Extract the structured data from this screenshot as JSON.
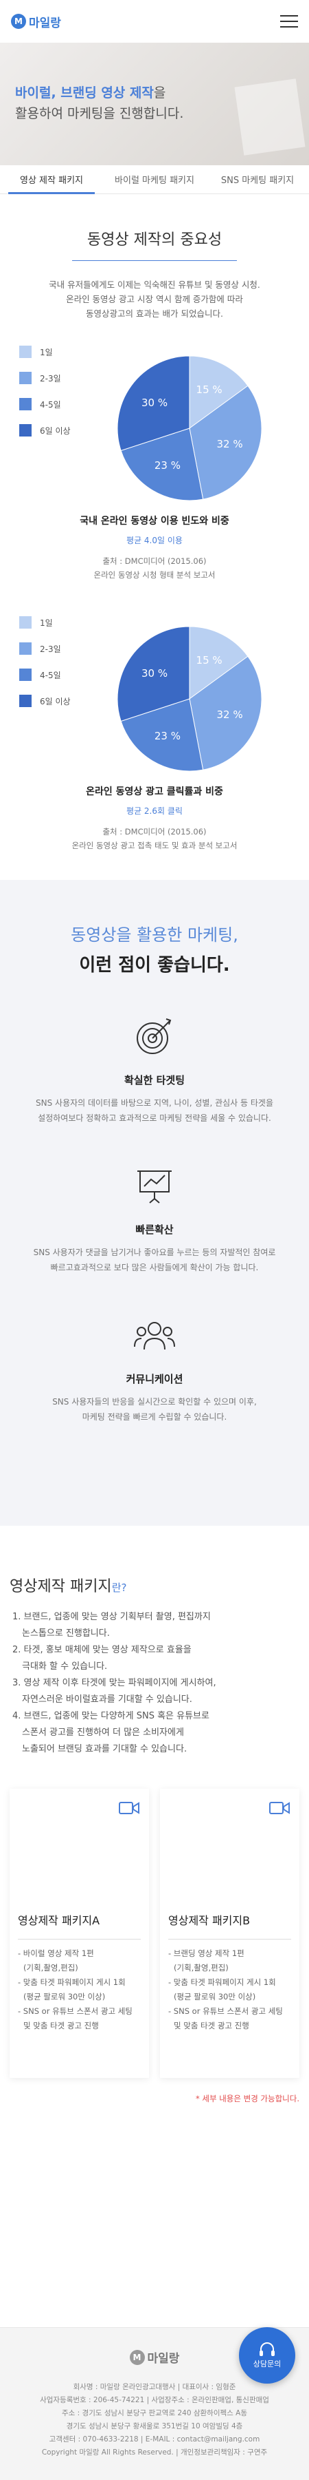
{
  "header": {
    "logo_text": "마일랑",
    "logo_mark": "M"
  },
  "hero": {
    "line1_highlight": "바이럴, 브랜딩 영상 제작",
    "line1_rest": "을",
    "line2": "활용하여 마케팅을 진행합니다."
  },
  "tabs": [
    {
      "label": "영상 제작 패키지"
    },
    {
      "label": "바이럴 마케팅 패키지"
    },
    {
      "label": "SNS 마케팅 패키지"
    }
  ],
  "importance": {
    "title": "동영상 제작의 중요성",
    "intro": [
      "국내 유저들에게도 이제는 익숙해진 유튜브 및 동영상 시청.",
      "온라인 동영상 광고 시장 역시 함께 증가함에 따라",
      "동영상광고의 효과는 배가 되었습니다."
    ]
  },
  "chart_data": [
    {
      "type": "pie",
      "title": "국내 온라인 동영상 이용 빈도와 비중",
      "subtitle": "평균 4.0일 이용",
      "source_lines": [
        "출처 : DMC미디어 (2015.06)",
        "온라인 동영상 시청 형태 분석 보고서"
      ],
      "categories": [
        "1일",
        "2-3일",
        "4-5일",
        "6일 이상"
      ],
      "values": [
        15,
        32,
        23,
        30
      ],
      "colors": [
        "#b9d0f2",
        "#7ea7e6",
        "#5585d6",
        "#3a69c4"
      ]
    },
    {
      "type": "pie",
      "title": "온라인 동영상 광고 클릭률과 비중",
      "subtitle": "평균 2.6회 클릭",
      "source_lines": [
        "출처 : DMC미디어 (2015.06)",
        "온라인 동영상 광고 접촉 태도 및 효과 분석 보고서"
      ],
      "categories": [
        "1일",
        "2-3일",
        "4-5일",
        "6일 이상"
      ],
      "values": [
        15,
        32,
        23,
        30
      ],
      "colors": [
        "#b9d0f2",
        "#7ea7e6",
        "#5585d6",
        "#3a69c4"
      ]
    }
  ],
  "benefits": {
    "title": "동영상을 활용한 마케팅,",
    "title2": "이런 점이 좋습니다.",
    "items": [
      {
        "name": "확실한 타겟팅",
        "desc": [
          "SNS 사용자의 데이터를 바탕으로 지역, 나이, 성별, 관심사 등 타겟을",
          "설정하여보다 정확하고 효과적으로 마케팅 전략을 세울 수 있습니다."
        ]
      },
      {
        "name": "빠른확산",
        "desc": [
          "SNS 사용자가 댓글을 남기거나 좋아요를 누르는 등의 자발적인 참여로",
          "빠르고효과적으로 보다 많은 사람들에게 확산이 가능 합니다."
        ]
      },
      {
        "name": "커뮤니케이션",
        "desc": [
          "SNS 사용자들의 반응을 실시간으로 확인할 수 있으며 이후,",
          "마케팅 전략을 빠르게 수립할 수 있습니다."
        ]
      }
    ]
  },
  "packages": {
    "title": "영상제작 패키지",
    "title_suffix": "란?",
    "list": [
      "1. 브랜드, 업종에 맞는 영상 기획부터 촬영, 편집까지",
      "   논스톱으로 진행합니다.",
      "2. 타겟, 홍보 매체에 맞는 영상 제작으로 효율을",
      "   극대화 할 수 있습니다.",
      "3. 영상 제작 이후 타겟에 맞는 파워페이지에 게시하여,",
      "   자연스러운 바이럴효과를 기대할 수 있습니다.",
      "4. 브랜드, 업종에 맞는 다양하게 SNS 혹은 유튜브로",
      "   스폰서 광고를 진행하여 더 많은 소비자에게",
      "   노출되어 브랜딩 효과를 기대할 수 있습니다."
    ],
    "cards": [
      {
        "name": "영상제작 패키지A",
        "items": [
          "- 바이럴 영상 제작 1편",
          "  (기획,촬영,편집)",
          "- 맞춤 타겟 파워페이지 게시 1회",
          "  (평균 팔로워 30만 이상)",
          "- SNS or 유튜브 스폰서 광고 세팅",
          "  및 맞춤 타겟 광고 진행"
        ]
      },
      {
        "name": "영상제작 패키지B",
        "items": [
          "- 브랜딩 영상 제작 1편",
          "  (기획,촬영,편집)",
          "- 맞춤 타겟 파워페이지 게시 1회",
          "  (평균 팔로워 30만 이상)",
          "- SNS or 유튜브 스폰서 광고 세팅",
          "  및 맞춤 타겟 광고 진행"
        ]
      }
    ],
    "note": "* 세부 내용은 변경 가능합니다."
  },
  "footer": {
    "lines": [
      "회사명 : 마일랑 온라인광고대행사 | 대표이사 : 임형준",
      "사업자등록번호 : 206-45-74221 | 사업장주소 : 온라인판매업, 통신판매업",
      "주소 : 경기도 성남시 분당구 판교역로 240 삼환하이펙스 A동",
      "경기도 성남시 분당구 황새울로 351번길 10 여암빌딩 4층",
      "고객센터 : 070-4633-2218 | E-MAIL : contact@mailjang.com",
      "Copyright 마일랑 All Rights Reserved. | 개인정보관리책임자 : 구연주"
    ]
  },
  "consult": {
    "label": "상담문의"
  }
}
